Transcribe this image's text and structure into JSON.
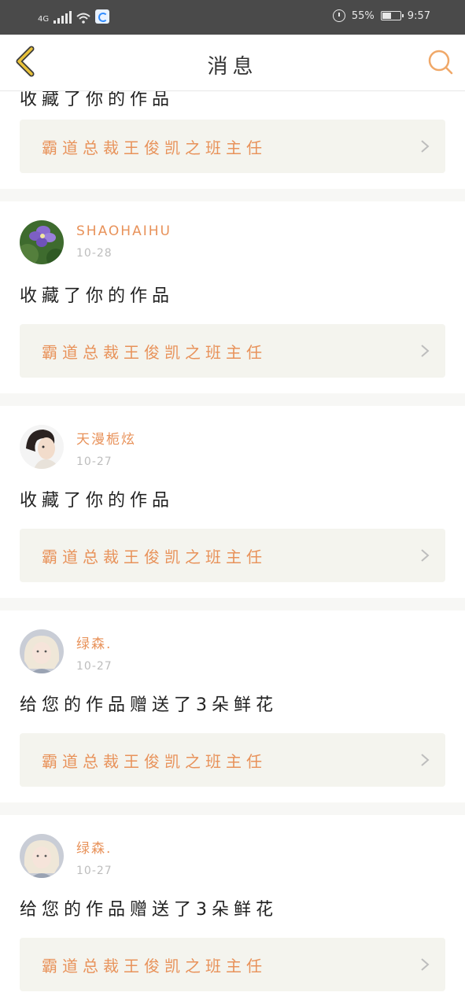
{
  "status_bar": {
    "network": "4G",
    "battery": "55%",
    "battery_level": 0.55,
    "time": "9:57"
  },
  "header": {
    "title": "消息",
    "back_icon": "chevron-left-icon",
    "search_icon": "search-icon"
  },
  "colors": {
    "accent": "#e8925a",
    "back_icon": "#e9c23a",
    "card_bg": "#f4f4ee"
  },
  "messages": [
    {
      "user": "",
      "date": "",
      "text": "收藏了你的作品",
      "work_title": "霸道总裁王俊凯之班主任"
    },
    {
      "user": "SHAOHAIHU",
      "date": "10-28",
      "text": "收藏了你的作品",
      "work_title": "霸道总裁王俊凯之班主任"
    },
    {
      "user": "天漫栀炫",
      "date": "10-27",
      "text": "收藏了你的作品",
      "work_title": "霸道总裁王俊凯之班主任"
    },
    {
      "user": "绿森.",
      "date": "10-27",
      "text": "给您的作品赠送了3朵鲜花",
      "work_title": "霸道总裁王俊凯之班主任"
    },
    {
      "user": "绿森.",
      "date": "10-27",
      "text": "给您的作品赠送了3朵鲜花",
      "work_title": "霸道总裁王俊凯之班主任"
    }
  ]
}
